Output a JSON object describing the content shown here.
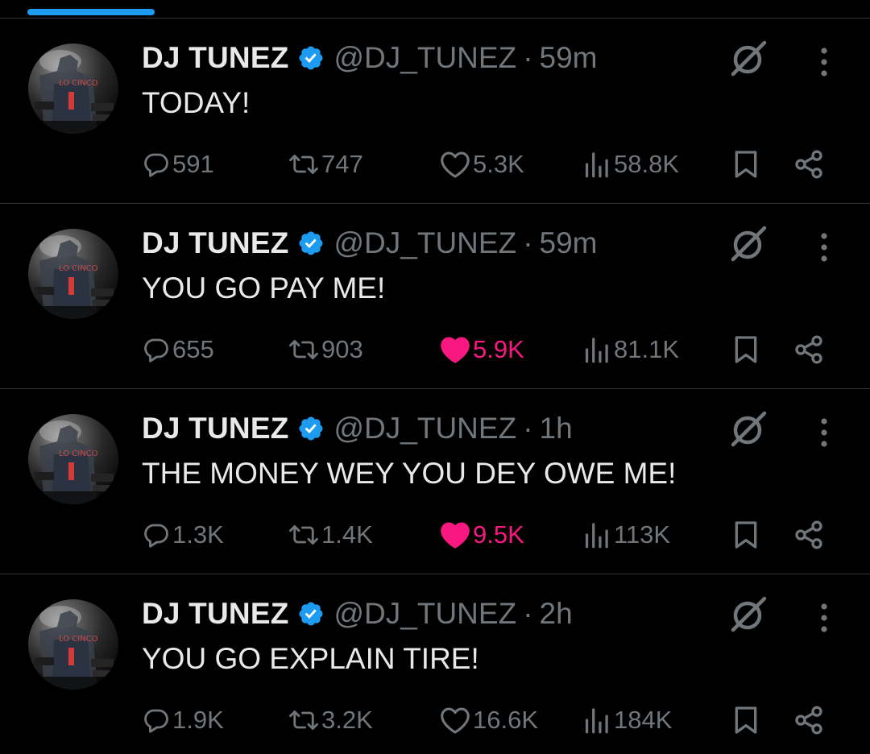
{
  "tweets": [
    {
      "name": "DJ TUNEZ",
      "handle": "@DJ_TUNEZ",
      "separator": "·",
      "time": "59m",
      "text": "TODAY!",
      "replies": "591",
      "retweets": "747",
      "likes": "5.3K",
      "liked": false,
      "views": "58.8K"
    },
    {
      "name": "DJ TUNEZ",
      "handle": "@DJ_TUNEZ",
      "separator": "·",
      "time": "59m",
      "text": "YOU GO PAY ME!",
      "replies": "655",
      "retweets": "903",
      "likes": "5.9K",
      "liked": true,
      "views": "81.1K"
    },
    {
      "name": "DJ TUNEZ",
      "handle": "@DJ_TUNEZ",
      "separator": "·",
      "time": "1h",
      "text": "THE MONEY WEY YOU DEY OWE ME!",
      "replies": "1.3K",
      "retweets": "1.4K",
      "likes": "9.5K",
      "liked": true,
      "views": "113K"
    },
    {
      "name": "DJ TUNEZ",
      "handle": "@DJ_TUNEZ",
      "separator": "·",
      "time": "2h",
      "text": "YOU GO EXPLAIN TIRE!",
      "replies": "1.9K",
      "retweets": "3.2K",
      "likes": "16.6K",
      "liked": false,
      "views": "184K"
    }
  ],
  "icons": {
    "verified": "verified-badge-icon",
    "grok": "grok-icon",
    "more": "more-vertical-icon",
    "reply": "reply-icon",
    "retweet": "retweet-icon",
    "like": "heart-icon",
    "views": "views-icon",
    "bookmark": "bookmark-icon",
    "share": "share-icon"
  },
  "colors": {
    "background": "#000000",
    "primary_text": "#e7e9ea",
    "secondary_text": "#71767b",
    "accent": "#1d9bf0",
    "like": "#f91880",
    "divider": "#2f3336"
  }
}
